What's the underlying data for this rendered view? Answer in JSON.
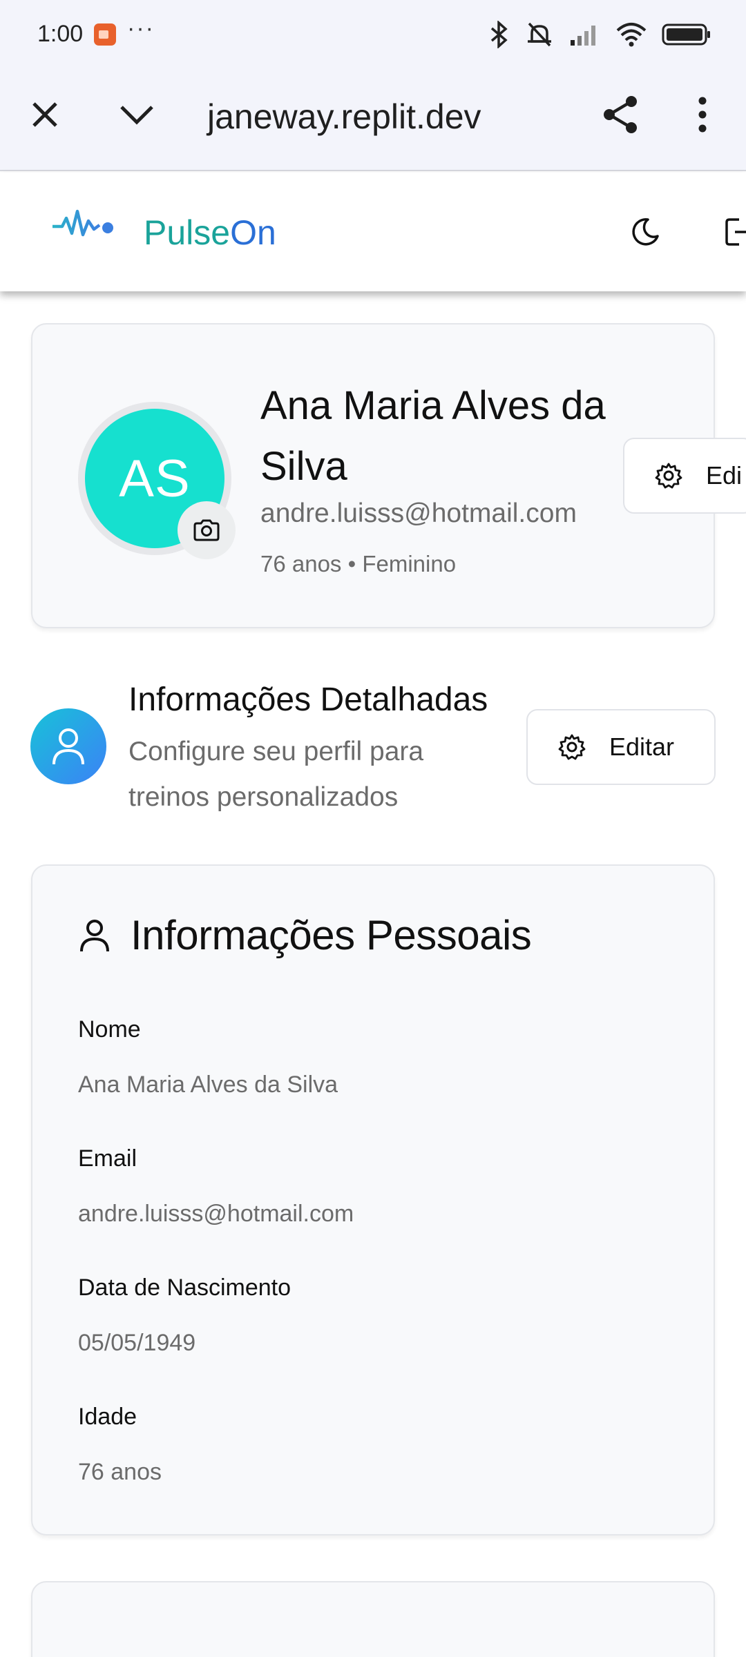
{
  "status_bar": {
    "time": "1:00",
    "more_indicator": "···",
    "icons": [
      "bluetooth-icon",
      "muted-icon",
      "signal-icon",
      "wifi-icon",
      "battery-icon"
    ]
  },
  "browser": {
    "url": "janeway.replit.dev",
    "icons": [
      "close-icon",
      "chevron-down-icon",
      "share-icon",
      "more-vert-icon"
    ]
  },
  "header": {
    "brand_part1": "Pulse",
    "brand_part2": "On",
    "brand_colors": {
      "pulse": "#1aa39a",
      "on": "#2a6fd6"
    },
    "icons": [
      "pulse-logo-icon",
      "moon-icon",
      "logout-icon"
    ]
  },
  "profile": {
    "initials": "AS",
    "name": "Ana Maria Alves da Silva",
    "email": "andre.luisss@hotmail.com",
    "meta": "76 anos • Feminino",
    "edit_label": "Edi",
    "avatar_color": "#16e0cf"
  },
  "detailed": {
    "title": "Informações Detalhadas",
    "subtitle": "Configure seu perfil para treinos personalizados",
    "edit_label": "Editar"
  },
  "personal": {
    "title": "Informações Pessoais",
    "fields": [
      {
        "label": "Nome",
        "value": "Ana Maria Alves da Silva"
      },
      {
        "label": "Email",
        "value": "andre.luisss@hotmail.com"
      },
      {
        "label": "Data de Nascimento",
        "value": "05/05/1949"
      },
      {
        "label": "Idade",
        "value": "76 anos"
      }
    ]
  }
}
